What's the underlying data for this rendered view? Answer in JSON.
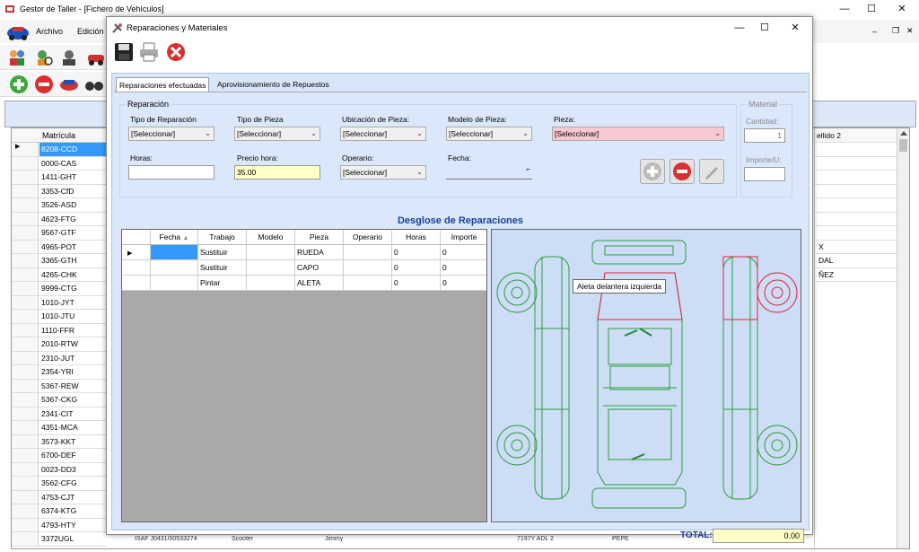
{
  "main": {
    "title": "Gestor de Taller - [Fichero de Vehículos]",
    "menu": [
      "Archivo",
      "Edición"
    ],
    "grid": {
      "header": "Matrícula",
      "right_header": "ellido 2",
      "rows": [
        "8208-CCD",
        "0000-CAS",
        "1411-GHT",
        "3353-CfD",
        "3526-ASD",
        "4623-FTG",
        "9567-GTF",
        "4965-POT",
        "3365-GTH",
        "4265-CHK",
        "9999-CTG",
        "1010-JYT",
        "1010-JTU",
        "1110-FFR",
        "2010-RTW",
        "2310-JUT",
        "2354-YRI",
        "5367-REW",
        "5367-CKG",
        "2341-CIT",
        "4351-MCA",
        "3573-KKT",
        "6700-DEF",
        "0023-DD3",
        "3562-CFG",
        "4753-CJT",
        "6374-KTG",
        "4793-HTY",
        "3372UGL"
      ],
      "right_rows": [
        "",
        "",
        "",
        "",
        "",
        "",
        "",
        "X",
        "DAL",
        "ÑEZ"
      ],
      "bottom_row": [
        "ISAF J0431/00533274",
        "Scooter",
        "Jimmy",
        "7197Y ADL 2",
        "PEPE"
      ]
    }
  },
  "dialog": {
    "title": "Reparaciones y Materiales",
    "tabs": [
      "Reparaciones efectuadas",
      "Aprovisionamiento de Repuestos"
    ],
    "reparacion": {
      "group_label": "Reparación",
      "tipo_reparacion_label": "Tipo de Reparación",
      "tipo_reparacion_value": "[Seleccionar]",
      "tipo_pieza_label": "Tipo de Pieza",
      "tipo_pieza_value": "[Seleccionar]",
      "ubicacion_label": "Ubicación de Pieza:",
      "ubicacion_value": "[Seleccionar]",
      "modelo_label": "Modelo de Pieza:",
      "modelo_value": "[Seleccionar]",
      "pieza_label": "Pieza:",
      "pieza_value": "[Seleccionar]",
      "horas_label": "Horas:",
      "horas_value": "",
      "precio_label": "Precio hora:",
      "precio_value": "35.00",
      "operario_label": "Operario:",
      "operario_value": "[Seleccionar]",
      "fecha_label": "Fecha:"
    },
    "material": {
      "group_label": "Material",
      "cantidad_label": "Cantidad:",
      "cantidad_value": "1",
      "importe_label": "Importe/U:",
      "importe_value": ""
    },
    "section_title": "Desglose de Reparaciones",
    "table": {
      "columns": [
        "Fecha",
        "Trabajo",
        "Modelo",
        "Pieza",
        "Operario",
        "Horas",
        "Importe"
      ],
      "rows": [
        [
          "",
          "Sustituir",
          "",
          "RUEDA",
          "",
          "0",
          "0"
        ],
        [
          "",
          "Sustituir",
          "",
          "CAPO",
          "",
          "0",
          "0"
        ],
        [
          "",
          "Pintar",
          "",
          "ALETA",
          "",
          "0",
          "0"
        ]
      ]
    },
    "tooltip": "Aleta delantera izquierda",
    "total_label": "TOTAL:",
    "total_value": "0.00"
  },
  "colors": {
    "selection": "#3399ff",
    "accent_blue": "#1a3f9a",
    "panel_blue": "#dbe7fb",
    "car_green": "#2e9e3e",
    "car_red": "#e0263c",
    "pieza_pink": "#f9c8cf",
    "precio_yellow": "#ffffc8"
  }
}
